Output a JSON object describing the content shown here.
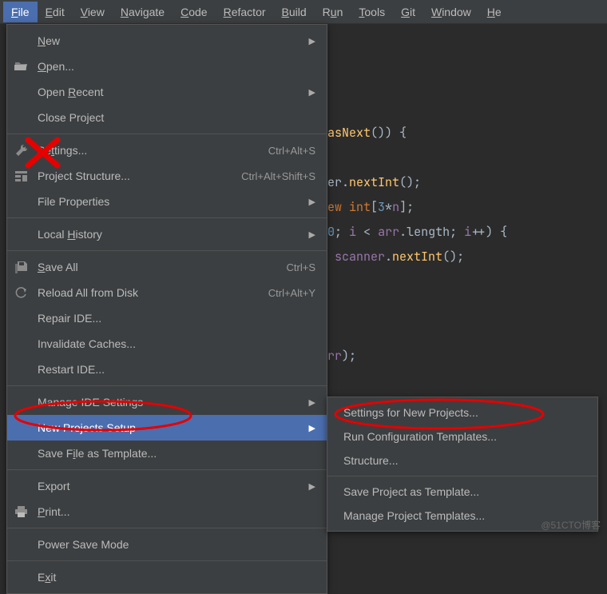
{
  "menubar": {
    "items": [
      "File",
      "Edit",
      "View",
      "Navigate",
      "Code",
      "Refactor",
      "Build",
      "Run",
      "Tools",
      "Git",
      "Window",
      "He"
    ]
  },
  "file_menu": {
    "new": "New",
    "open": "Open...",
    "open_recent": "Open Recent",
    "close_project": "Close Project",
    "settings": "Settings...",
    "settings_shortcut": "Ctrl+Alt+S",
    "project_structure": "Project Structure...",
    "project_structure_shortcut": "Ctrl+Alt+Shift+S",
    "file_properties": "File Properties",
    "local_history": "Local History",
    "save_all": "Save All",
    "save_all_shortcut": "Ctrl+S",
    "reload_all": "Reload All from Disk",
    "reload_all_shortcut": "Ctrl+Alt+Y",
    "repair_ide": "Repair IDE...",
    "invalidate_caches": "Invalidate Caches...",
    "restart_ide": "Restart IDE...",
    "manage_ide_settings": "Manage IDE Settings",
    "new_projects_setup": "New Projects Setup",
    "save_file_as_template": "Save File as Template...",
    "export": "Export",
    "print": "Print...",
    "power_save_mode": "Power Save Mode",
    "exit": "Exit"
  },
  "submenu": {
    "settings_new_projects": "Settings for New Projects...",
    "run_config_templates": "Run Configuration Templates...",
    "structure": "Structure...",
    "save_project_template": "Save Project as Template...",
    "manage_project_templates": "Manage Project Templates..."
  },
  "code": {
    "line1_a": "asNext",
    "line1_b": "()) {",
    "line2_a": "er.",
    "line2_b": "nextInt",
    "line2_c": "();",
    "line3_a": "ew int",
    "line3_b": "[",
    "line3_c": "3",
    "line3_d": "*",
    "line3_e": "n",
    "line3_f": "];",
    "line4_a": "0",
    "line4_b": "; ",
    "line4_c": "i",
    "line4_d": " < ",
    "line4_e": "arr",
    "line4_f": ".length; ",
    "line4_g": "i",
    "line4_h": "++) {",
    "line5_a": "scanner",
    "line5_b": ".",
    "line5_c": "nextInt",
    "line5_d": "();",
    "line6_a": "rr",
    "line6_b": ");"
  },
  "watermark": "@51CTO博客"
}
